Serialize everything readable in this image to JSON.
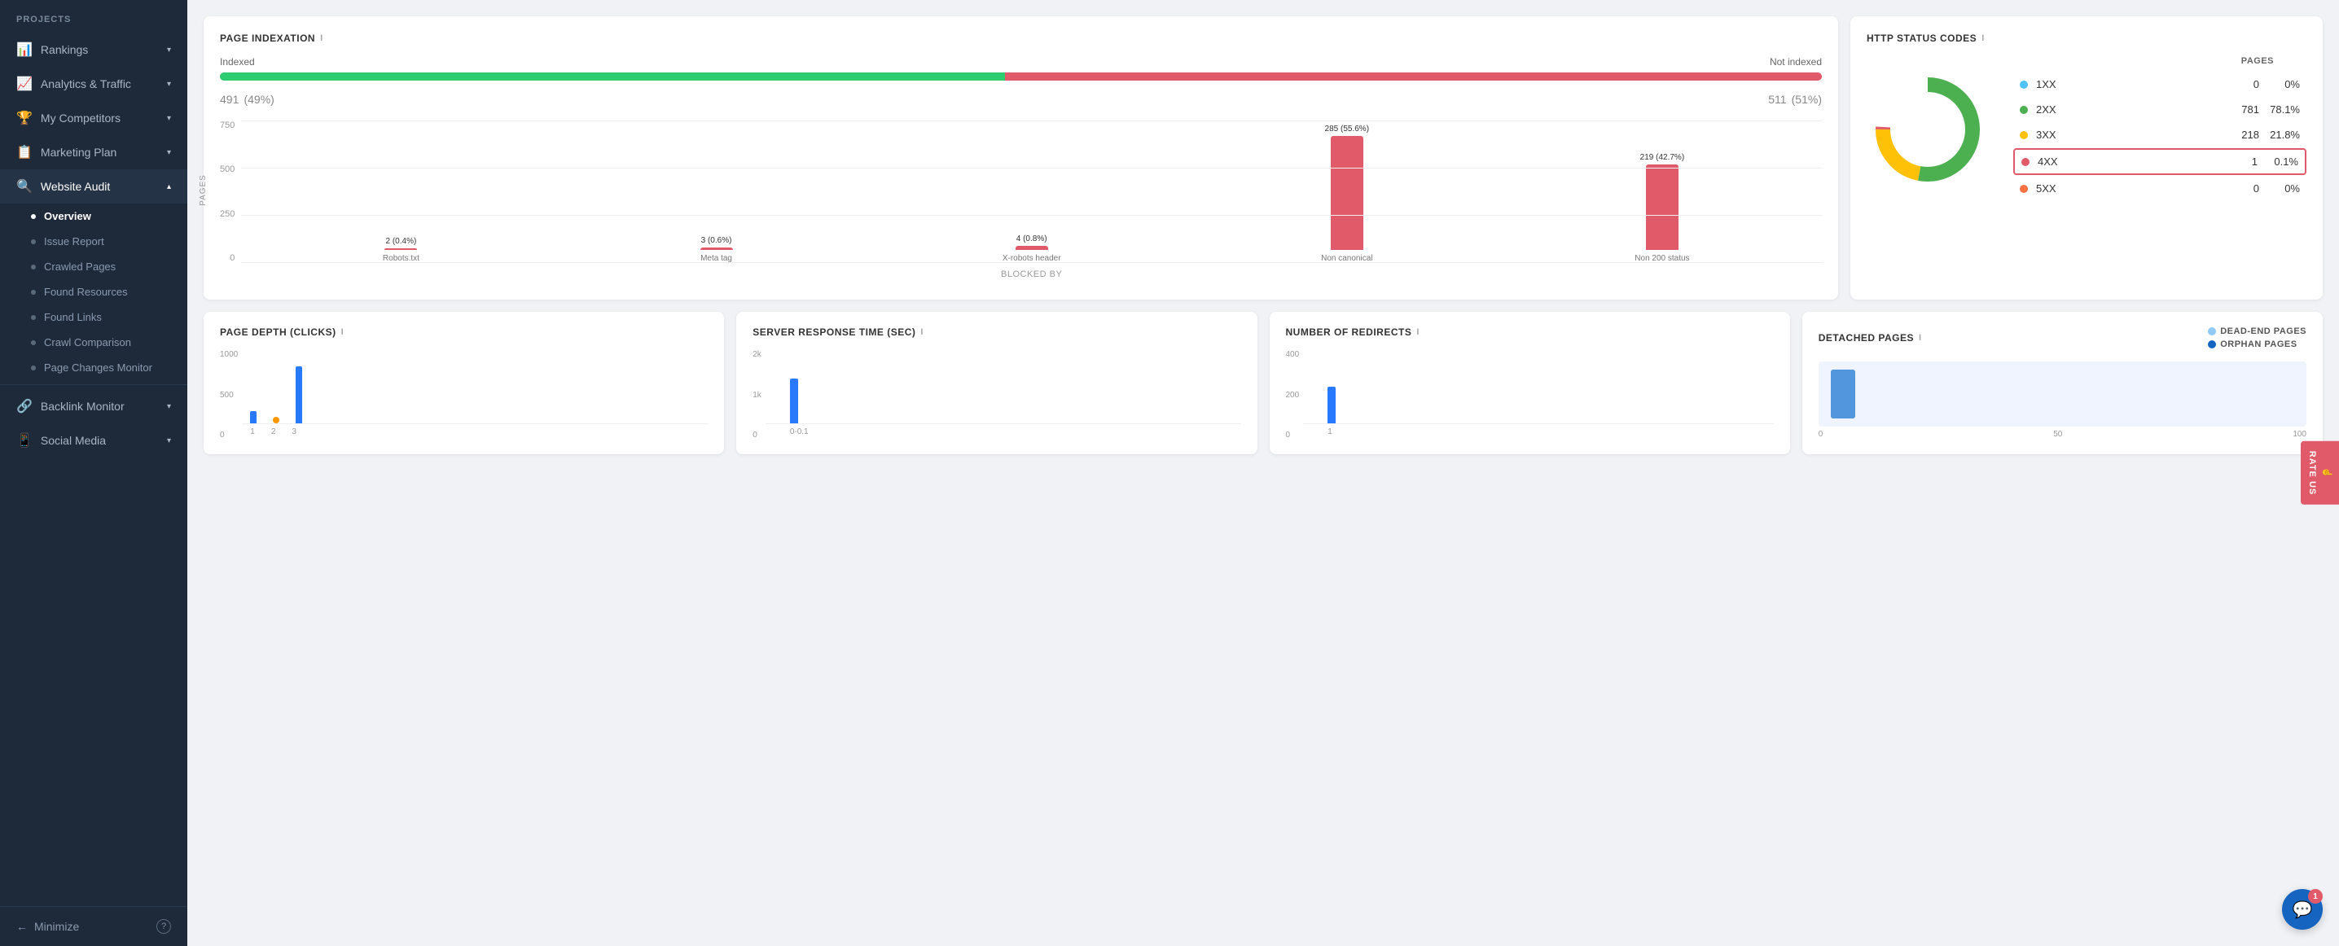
{
  "sidebar": {
    "projects_label": "PROJECTS",
    "items": [
      {
        "id": "rankings",
        "label": "Rankings",
        "icon": "📊",
        "has_chevron": true
      },
      {
        "id": "analytics",
        "label": "Analytics & Traffic",
        "icon": "📈",
        "has_chevron": true
      },
      {
        "id": "competitors",
        "label": "My Competitors",
        "icon": "🏆",
        "has_chevron": true
      },
      {
        "id": "marketing",
        "label": "Marketing Plan",
        "icon": "📋",
        "has_chevron": true
      },
      {
        "id": "website-audit",
        "label": "Website Audit",
        "icon": "🔍",
        "has_chevron": true,
        "active": true
      }
    ],
    "sub_items": [
      {
        "id": "overview",
        "label": "Overview",
        "active": true
      },
      {
        "id": "issue-report",
        "label": "Issue Report"
      },
      {
        "id": "crawled-pages",
        "label": "Crawled Pages"
      },
      {
        "id": "found-resources",
        "label": "Found Resources"
      },
      {
        "id": "found-links",
        "label": "Found Links"
      },
      {
        "id": "crawl-comparison",
        "label": "Crawl Comparison"
      },
      {
        "id": "page-changes",
        "label": "Page Changes Monitor"
      }
    ],
    "other_items": [
      {
        "id": "backlink",
        "label": "Backlink Monitor",
        "icon": "🔗",
        "has_chevron": true
      },
      {
        "id": "social",
        "label": "Social Media",
        "icon": "📱",
        "has_chevron": true
      }
    ],
    "minimize_label": "Minimize"
  },
  "page_indexation": {
    "title": "PAGE INDEXATION",
    "info": "i",
    "label_indexed": "Indexed",
    "label_not_indexed": "Not indexed",
    "indexed_count": "491",
    "indexed_pct": "(49%)",
    "not_indexed_count": "511",
    "not_indexed_pct": "(51%)",
    "indexed_width_pct": 49,
    "bar_labels": [
      "750",
      "500",
      "250",
      "0"
    ],
    "bars": [
      {
        "label": "2 (0.4%)",
        "height": 2,
        "x_label": "Robots.txt"
      },
      {
        "label": "3 (0.6%)",
        "height": 3,
        "x_label": "Meta tag"
      },
      {
        "label": "4 (0.8%)",
        "height": 5,
        "x_label": "X-robots header"
      },
      {
        "label": "285 (55.6%)",
        "height": 165,
        "x_label": "Non canonical"
      },
      {
        "label": "219 (42.7%)",
        "height": 125,
        "x_label": "Non 200 status"
      }
    ],
    "x_axis_label": "BLOCKED BY",
    "y_axis_label": "PAGES"
  },
  "http_status": {
    "title": "HTTP STATUS CODES",
    "info": "i",
    "pages_label": "PAGES",
    "rows": [
      {
        "code": "1XX",
        "color": "#4fc3f7",
        "pages": "0",
        "pct": "0%",
        "highlighted": false
      },
      {
        "code": "2XX",
        "color": "#4caf50",
        "pages": "781",
        "pct": "78.1%",
        "highlighted": false
      },
      {
        "code": "3XX",
        "color": "#ffc107",
        "pages": "218",
        "pct": "21.8%",
        "highlighted": false
      },
      {
        "code": "4XX",
        "color": "#e05a6a",
        "pages": "1",
        "pct": "0.1%",
        "highlighted": true
      },
      {
        "code": "5XX",
        "color": "#ff7043",
        "pages": "0",
        "pct": "0%",
        "highlighted": false
      }
    ],
    "donut": {
      "green_pct": 78,
      "yellow_pct": 22,
      "red_pct": 0.1
    }
  },
  "page_depth": {
    "title": "PAGE DEPTH (CLICKS)",
    "info": "i",
    "y_labels": [
      "1000",
      "500",
      "0"
    ],
    "x_labels": [
      "1",
      "2",
      "3"
    ],
    "bars": [
      {
        "height": 15,
        "type": "bar"
      },
      {
        "height": 5,
        "type": "dot"
      },
      {
        "height": 80,
        "type": "bar"
      }
    ]
  },
  "server_response": {
    "title": "SERVER RESPONSE TIME (SEC)",
    "info": "i",
    "y_labels": [
      "2k",
      "1k",
      "0"
    ],
    "x_labels": [
      "0-0.1"
    ],
    "bars": [
      {
        "height": 60,
        "type": "bar"
      }
    ]
  },
  "redirects": {
    "title": "NUMBER OF REDIRECTS",
    "info": "i",
    "y_labels": [
      "400",
      "200",
      "0"
    ],
    "x_labels": [
      "1"
    ],
    "bars": [
      {
        "height": 50,
        "type": "bar"
      }
    ]
  },
  "detached_pages": {
    "title": "DETACHED PAGES",
    "info": "i",
    "legend": [
      {
        "label": "DEAD-END PAGES",
        "color": "#90caf9"
      },
      {
        "label": "ORPHAN PAGES",
        "color": "#1565c0"
      }
    ],
    "x_labels": [
      "0",
      "50",
      "100"
    ]
  },
  "rate_us": {
    "label": "RATE US"
  },
  "chat": {
    "badge": "1"
  }
}
